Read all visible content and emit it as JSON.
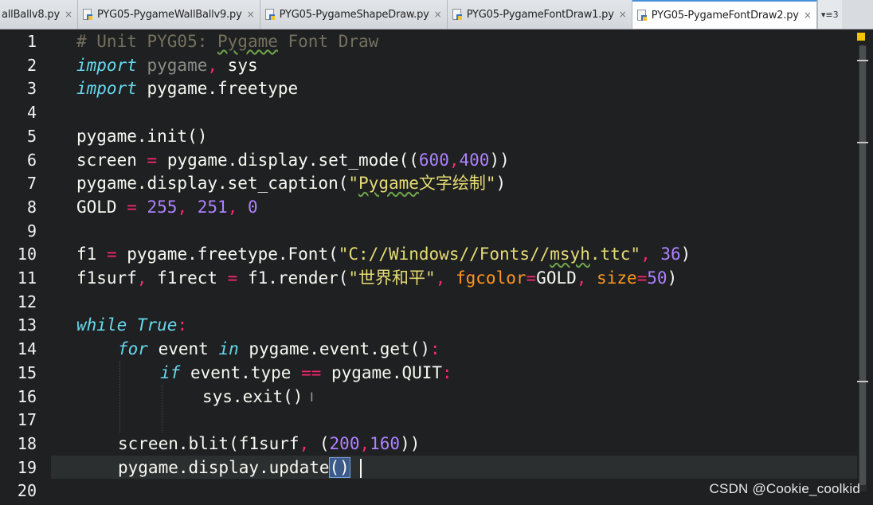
{
  "tabs": [
    {
      "label": "allBallv8.py",
      "active": false
    },
    {
      "label": "PYG05-PygameWallBallv9.py",
      "active": false
    },
    {
      "label": "PYG05-PygameShapeDraw.py",
      "active": false
    },
    {
      "label": "PYG05-PygameFontDraw1.py",
      "active": false
    },
    {
      "label": "PYG05-PygameFontDraw2.py",
      "active": true
    }
  ],
  "tab_close_glyph": "×",
  "tab_overflow": "▾≡3",
  "line_numbers": [
    "1",
    "2",
    "3",
    "4",
    "5",
    "6",
    "7",
    "8",
    "9",
    "10",
    "11",
    "12",
    "13",
    "14",
    "15",
    "16",
    "17",
    "18",
    "19",
    "20"
  ],
  "code": {
    "l1": "# Unit PYG05: ",
    "l1b": "Pygame",
    "l1c": " Font Draw",
    "l2a": "import",
    "l2b": " pygame",
    "l2c": ",",
    "l2d": " sys",
    "l3a": "import",
    "l3b": " pygame.freetype",
    "l5": "pygame.init()",
    "l6a": "screen ",
    "l6b": "=",
    "l6c": " pygame.display.set_mode((",
    "l6d": "600",
    "l6e": ",",
    "l6f": "400",
    "l6g": "))",
    "l7a": "pygame.display.set_caption(",
    "l7b": "\"",
    "l7c": "Pygame",
    "l7d": "文字绘制\"",
    "l7e": ")",
    "l8a": "GOLD ",
    "l8b": "=",
    "l8c": " 255",
    "l8d": ",",
    "l8e": " 251",
    "l8f": ",",
    "l8g": " 0",
    "l10a": "f1 ",
    "l10b": "=",
    "l10c": " pygame.freetype.Font(",
    "l10d": "\"C://Windows//Fonts//",
    "l10e": "msyh",
    "l10f": ".ttc\"",
    "l10g": ",",
    "l10h": " 36",
    "l10i": ")",
    "l11a": "f1surf",
    "l11b": ",",
    "l11c": " f1rect ",
    "l11d": "=",
    "l11e": " f1.render(",
    "l11f": "\"世界和平\"",
    "l11g": ",",
    "l11h": " fgcolor",
    "l11i": "=",
    "l11j": "GOLD",
    "l11k": ",",
    "l11l": " size",
    "l11m": "=",
    "l11n": "50",
    "l11o": ")",
    "l13a": "while",
    "l13b": " True",
    "l13c": ":",
    "l14a": "for",
    "l14b": " event ",
    "l14c": "in",
    "l14d": " pygame.event.get()",
    "l14e": ":",
    "l15a": "if",
    "l15b": " event.type ",
    "l15c": "==",
    "l15d": " pygame.QUIT",
    "l15e": ":",
    "l16": "sys.exit()",
    "l18a": "screen.blit(f1surf",
    "l18b": ",",
    "l18c": " (",
    "l18d": "200",
    "l18e": ",",
    "l18f": "160",
    "l18g": "))",
    "l19a": "pygame.display.update",
    "l19b": "()"
  },
  "watermark": "CSDN @Cookie_coolkid",
  "colors": {
    "background": "#1e2021",
    "comment": "#75715e",
    "keyword": "#66d9ef",
    "number": "#ae81ff",
    "string": "#e6db74",
    "operator": "#f92672",
    "parameter": "#fd971f",
    "marker": "#f5c400"
  }
}
